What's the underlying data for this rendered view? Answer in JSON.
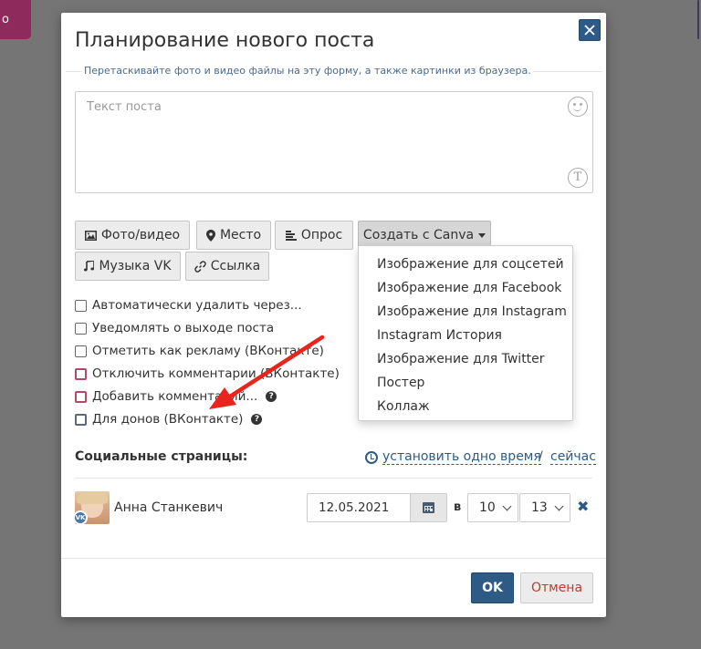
{
  "background": {
    "left_tag_text": "о"
  },
  "modal": {
    "title": "Планирование нового поста",
    "close_icon": "close-icon",
    "hint": "Перетаскивайте фото и видео файлы на эту форму, а также картинки из браузера.",
    "post_text": {
      "placeholder": "Текст поста",
      "value": ""
    }
  },
  "toolbar": {
    "photo_video": "Фото/видео",
    "place": "Место",
    "poll": "Опрос",
    "canva": "Создать с Canva",
    "music_vk": "Музыка VK",
    "link": "Ссылка"
  },
  "canva_menu": {
    "items": [
      "Изображение для соцсетей",
      "Изображение для Facebook",
      "Изображение для Instagram",
      "Instagram История",
      "Изображение для Twitter",
      "Постер",
      "Коллаж"
    ]
  },
  "options": [
    {
      "label": "Автоматически удалить через...",
      "checked": false
    },
    {
      "label": "Уведомлять о выходе поста",
      "checked": false
    },
    {
      "label": "Отметить как рекламу (ВКонтакте)",
      "checked": false
    },
    {
      "label": "Отключить комментарии (ВКонтакте)",
      "checked": false
    },
    {
      "label": "Добавить комментарий...",
      "checked": false
    },
    {
      "label": "Для донов (ВКонтакте)",
      "checked": false
    }
  ],
  "social": {
    "label": "Социальные страницы:",
    "set_one_time": "установить одно время",
    "separator": "/",
    "now": "сейчас"
  },
  "account": {
    "name": "Анна Станкевич",
    "network_badge": "VK",
    "date": "12.05.2021",
    "at_label": "в",
    "hour": "10",
    "minute": "13"
  },
  "footer": {
    "ok": "OK",
    "cancel": "Отмена"
  },
  "colors": {
    "primary": "#2e5a86",
    "cancel_text": "#c0392b",
    "arrow": "#e8241c"
  }
}
